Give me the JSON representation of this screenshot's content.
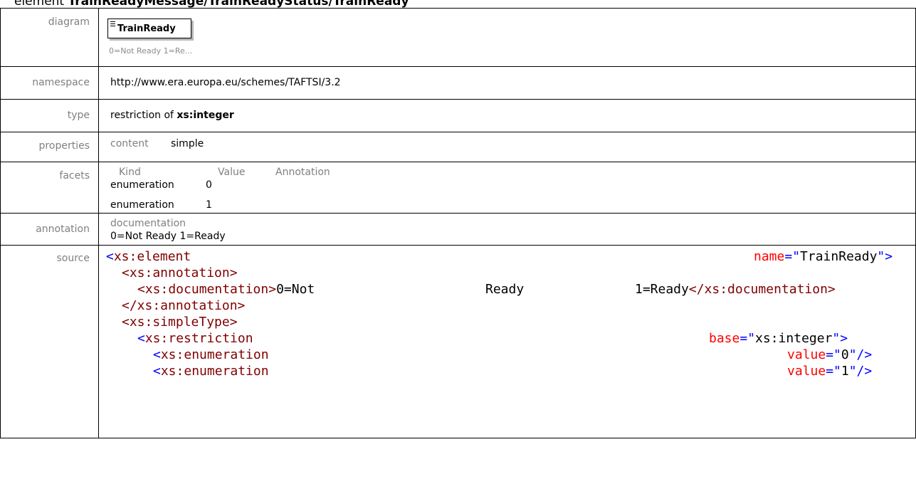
{
  "heading": {
    "prefix": "element",
    "path": "TrainReadyMessage/TrainReadyStatus/TrainReady"
  },
  "labels": {
    "diagram": "diagram",
    "namespace": "namespace",
    "type": "type",
    "properties": "properties",
    "facets": "facets",
    "annotation": "annotation",
    "source": "source"
  },
  "diagram": {
    "element_name": "TrainReady",
    "note": "0=Not Ready 1=Re..."
  },
  "namespace": "http://www.era.europa.eu/schemes/TAFTSI/3.2",
  "type": {
    "prefix": "restriction of",
    "base": "xs:integer"
  },
  "properties": {
    "key": "content",
    "value": "simple"
  },
  "facets": {
    "headers": [
      "Kind",
      "Value",
      "Annotation"
    ],
    "rows": [
      {
        "kind": "enumeration",
        "value": "0"
      },
      {
        "kind": "enumeration",
        "value": "1"
      }
    ]
  },
  "annotation": {
    "key": "documentation",
    "text": "0=Not Ready 1=Ready"
  },
  "source": {
    "l1_open": "<",
    "l1_tag": "xs:element",
    "l1_attr": "name",
    "l1_eq": "=\"",
    "l1_val": "TrainReady",
    "l1_close": "\">",
    "l2_tag": "<xs:annotation>",
    "l3_open": "<xs:documentation>",
    "l3_word1": "0=Not",
    "l3_word2": "Ready",
    "l3_word3": "1=Ready",
    "l3_close": "</xs:documentation>",
    "l4_tag": "</xs:annotation>",
    "l5_tag": "<xs:simpleType>",
    "l6_open": "<",
    "l6_tag": "xs:restriction",
    "l6_attr": "base",
    "l6_eq": "=\"",
    "l6_val": "xs:integer",
    "l6_close": "\">",
    "l7_open": "<",
    "l7_tag": "xs:enumeration",
    "l7_attr": "value",
    "l7_eq": "=\"",
    "l7_val": "0",
    "l7_close": "\"/>",
    "l8_open": "<",
    "l8_tag": "xs:enumeration",
    "l8_attr": "value",
    "l8_eq": "=\"",
    "l8_val": "1",
    "l8_close": "\"/>"
  }
}
